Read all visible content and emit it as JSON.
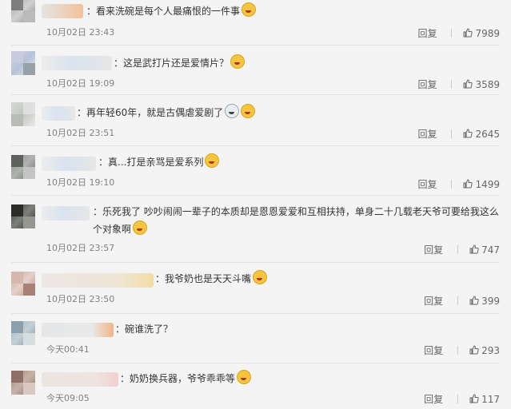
{
  "comments": [
    {
      "text": "看来洗碗是每个人最痛恨的一件事",
      "time": "10月02日 23:43",
      "reply": "回复",
      "likes": "7989"
    },
    {
      "text": "这是武打片还是爱情片？",
      "time": "10月02日 19:09",
      "reply": "回复",
      "likes": "3589"
    },
    {
      "text": "再年轻60年，就是古偶虐爱剧了",
      "time": "10月02日 23:51",
      "reply": "回复",
      "likes": "2645"
    },
    {
      "text": "真...打是亲骂是爱系列",
      "time": "10月02日 19:10",
      "reply": "回复",
      "likes": "1499"
    },
    {
      "text": "乐死我了 吵吵闹闹一辈子的本质却是恩恩爱爱和互相扶持，单身二十几载老天爷可要给我这么个对象啊",
      "time": "10月02日 23:57",
      "reply": "回复",
      "likes": "747"
    },
    {
      "text": "我爷奶也是天天斗嘴",
      "time": "10月02日 23:50",
      "reply": "回复",
      "likes": "399"
    },
    {
      "text": "碗谁洗了？",
      "time": "今天00:41",
      "reply": "回复",
      "likes": "293"
    },
    {
      "text": "奶奶换兵器，爷爷乖乖等",
      "time": "今天09:05",
      "reply": "回复",
      "likes": "117"
    }
  ],
  "colon": "："
}
